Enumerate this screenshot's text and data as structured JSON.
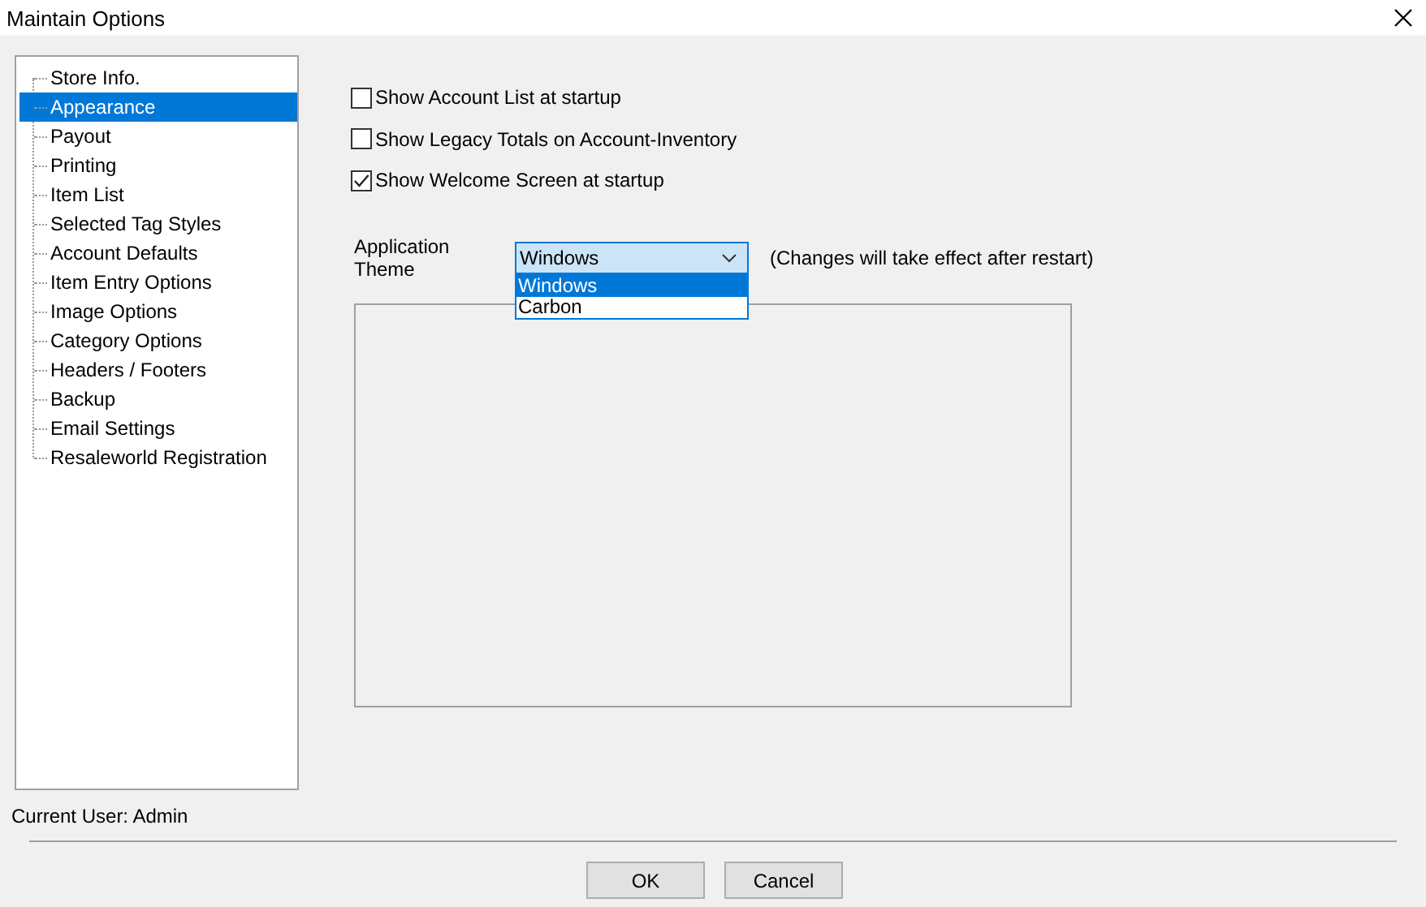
{
  "window": {
    "title": "Maintain Options"
  },
  "sidebar": {
    "items": [
      {
        "label": "Store Info.",
        "selected": false
      },
      {
        "label": "Appearance",
        "selected": true
      },
      {
        "label": "Payout",
        "selected": false
      },
      {
        "label": "Printing",
        "selected": false
      },
      {
        "label": "Item List",
        "selected": false
      },
      {
        "label": "Selected Tag Styles",
        "selected": false
      },
      {
        "label": "Account Defaults",
        "selected": false
      },
      {
        "label": "Item Entry Options",
        "selected": false
      },
      {
        "label": "Image Options",
        "selected": false
      },
      {
        "label": "Category Options",
        "selected": false
      },
      {
        "label": "Headers / Footers",
        "selected": false
      },
      {
        "label": "Backup",
        "selected": false
      },
      {
        "label": "Email Settings",
        "selected": false
      },
      {
        "label": "Resaleworld Registration",
        "selected": false
      }
    ]
  },
  "options": [
    {
      "label": "Show Account List at startup",
      "checked": false
    },
    {
      "label": "Show Legacy Totals on Account-Inventory",
      "checked": false
    },
    {
      "label": "Show Welcome Screen at startup",
      "checked": true
    }
  ],
  "theme": {
    "label": "Application Theme",
    "value": "Windows",
    "expanded": true,
    "options": [
      {
        "label": "Windows",
        "selected": true
      },
      {
        "label": "Carbon",
        "selected": false
      }
    ],
    "note": "(Changes will take effect after restart)"
  },
  "status": "Current User: Admin",
  "buttons": [
    "OK",
    "Cancel"
  ]
}
